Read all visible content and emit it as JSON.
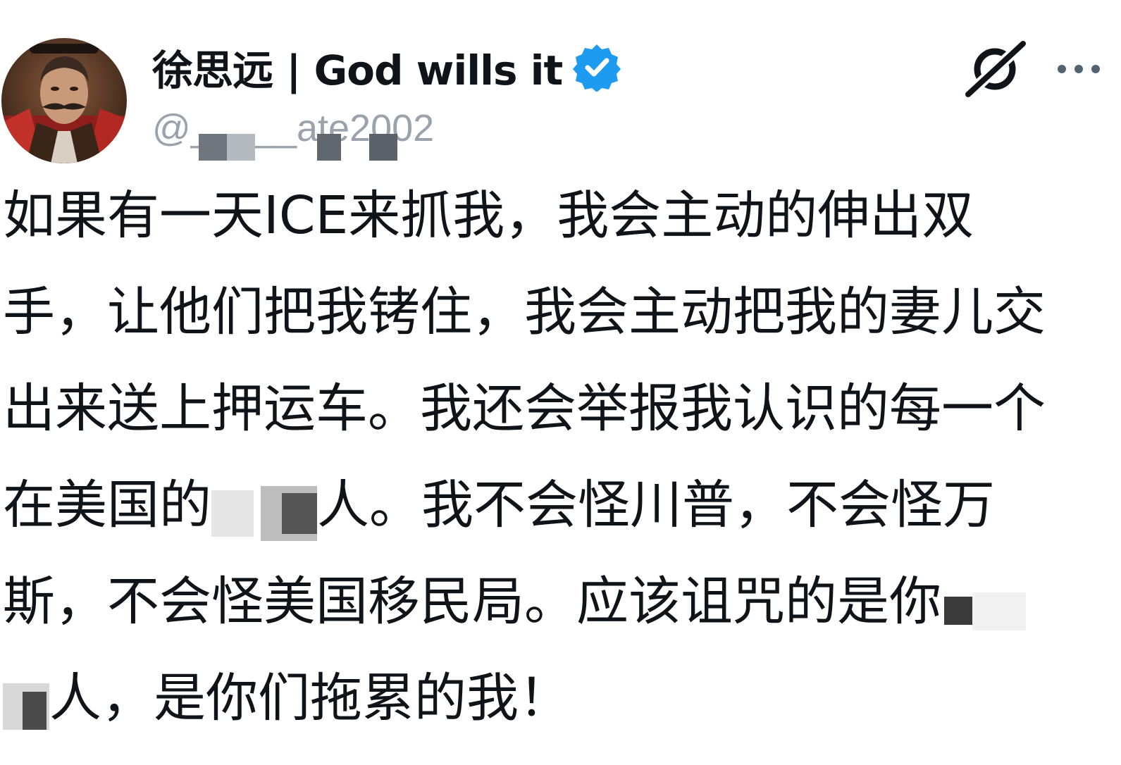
{
  "tweet": {
    "author": {
      "display_name": "徐思远 | God wills it",
      "handle": "@_____ate2002",
      "verified": true,
      "avatar_icon": "profile-avatar"
    },
    "actions": {
      "grok_icon": "grok-icon",
      "more_icon": "more-horizontal-icon"
    },
    "body_lines": [
      "如果有一天ICE来抓我，我会主动的伸出双",
      "手，让他们把我铐住，我会主动把我的妻儿交",
      "出来送上押运车。我还会举报我认识的每一个",
      {
        "before": "在美国的",
        "after": "人。我不会怪川普，不会怪万"
      },
      {
        "before": "斯，不会怪美国移民局。应该诅咒的是你",
        "after": ""
      },
      {
        "before": "",
        "after": "人，是你们拖累的我！"
      }
    ],
    "colors": {
      "text": "#0f1419",
      "secondary": "#9aa3ab",
      "verified_badge": "#1d9bf0",
      "background": "#ffffff"
    }
  }
}
